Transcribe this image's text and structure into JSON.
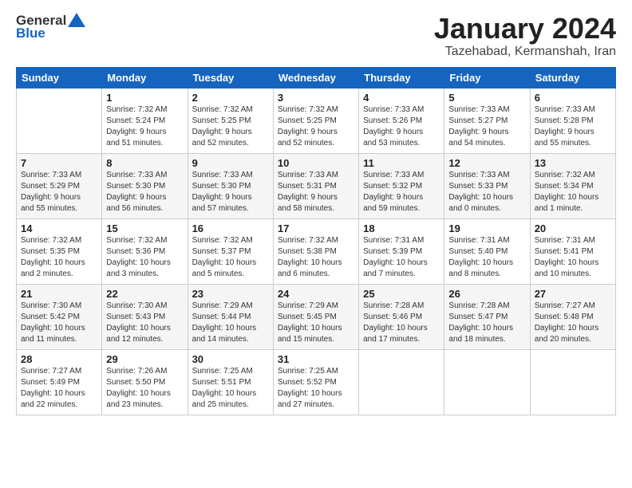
{
  "logo": {
    "general": "General",
    "blue": "Blue"
  },
  "title": "January 2024",
  "location": "Tazehabad, Kermanshah, Iran",
  "headers": [
    "Sunday",
    "Monday",
    "Tuesday",
    "Wednesday",
    "Thursday",
    "Friday",
    "Saturday"
  ],
  "weeks": [
    [
      {
        "day": "",
        "info": ""
      },
      {
        "day": "1",
        "info": "Sunrise: 7:32 AM\nSunset: 5:24 PM\nDaylight: 9 hours\nand 51 minutes."
      },
      {
        "day": "2",
        "info": "Sunrise: 7:32 AM\nSunset: 5:25 PM\nDaylight: 9 hours\nand 52 minutes."
      },
      {
        "day": "3",
        "info": "Sunrise: 7:32 AM\nSunset: 5:25 PM\nDaylight: 9 hours\nand 52 minutes."
      },
      {
        "day": "4",
        "info": "Sunrise: 7:33 AM\nSunset: 5:26 PM\nDaylight: 9 hours\nand 53 minutes."
      },
      {
        "day": "5",
        "info": "Sunrise: 7:33 AM\nSunset: 5:27 PM\nDaylight: 9 hours\nand 54 minutes."
      },
      {
        "day": "6",
        "info": "Sunrise: 7:33 AM\nSunset: 5:28 PM\nDaylight: 9 hours\nand 55 minutes."
      }
    ],
    [
      {
        "day": "7",
        "info": "Sunrise: 7:33 AM\nSunset: 5:29 PM\nDaylight: 9 hours\nand 55 minutes."
      },
      {
        "day": "8",
        "info": "Sunrise: 7:33 AM\nSunset: 5:30 PM\nDaylight: 9 hours\nand 56 minutes."
      },
      {
        "day": "9",
        "info": "Sunrise: 7:33 AM\nSunset: 5:30 PM\nDaylight: 9 hours\nand 57 minutes."
      },
      {
        "day": "10",
        "info": "Sunrise: 7:33 AM\nSunset: 5:31 PM\nDaylight: 9 hours\nand 58 minutes."
      },
      {
        "day": "11",
        "info": "Sunrise: 7:33 AM\nSunset: 5:32 PM\nDaylight: 9 hours\nand 59 minutes."
      },
      {
        "day": "12",
        "info": "Sunrise: 7:33 AM\nSunset: 5:33 PM\nDaylight: 10 hours\nand 0 minutes."
      },
      {
        "day": "13",
        "info": "Sunrise: 7:32 AM\nSunset: 5:34 PM\nDaylight: 10 hours\nand 1 minute."
      }
    ],
    [
      {
        "day": "14",
        "info": "Sunrise: 7:32 AM\nSunset: 5:35 PM\nDaylight: 10 hours\nand 2 minutes."
      },
      {
        "day": "15",
        "info": "Sunrise: 7:32 AM\nSunset: 5:36 PM\nDaylight: 10 hours\nand 3 minutes."
      },
      {
        "day": "16",
        "info": "Sunrise: 7:32 AM\nSunset: 5:37 PM\nDaylight: 10 hours\nand 5 minutes."
      },
      {
        "day": "17",
        "info": "Sunrise: 7:32 AM\nSunset: 5:38 PM\nDaylight: 10 hours\nand 6 minutes."
      },
      {
        "day": "18",
        "info": "Sunrise: 7:31 AM\nSunset: 5:39 PM\nDaylight: 10 hours\nand 7 minutes."
      },
      {
        "day": "19",
        "info": "Sunrise: 7:31 AM\nSunset: 5:40 PM\nDaylight: 10 hours\nand 8 minutes."
      },
      {
        "day": "20",
        "info": "Sunrise: 7:31 AM\nSunset: 5:41 PM\nDaylight: 10 hours\nand 10 minutes."
      }
    ],
    [
      {
        "day": "21",
        "info": "Sunrise: 7:30 AM\nSunset: 5:42 PM\nDaylight: 10 hours\nand 11 minutes."
      },
      {
        "day": "22",
        "info": "Sunrise: 7:30 AM\nSunset: 5:43 PM\nDaylight: 10 hours\nand 12 minutes."
      },
      {
        "day": "23",
        "info": "Sunrise: 7:29 AM\nSunset: 5:44 PM\nDaylight: 10 hours\nand 14 minutes."
      },
      {
        "day": "24",
        "info": "Sunrise: 7:29 AM\nSunset: 5:45 PM\nDaylight: 10 hours\nand 15 minutes."
      },
      {
        "day": "25",
        "info": "Sunrise: 7:28 AM\nSunset: 5:46 PM\nDaylight: 10 hours\nand 17 minutes."
      },
      {
        "day": "26",
        "info": "Sunrise: 7:28 AM\nSunset: 5:47 PM\nDaylight: 10 hours\nand 18 minutes."
      },
      {
        "day": "27",
        "info": "Sunrise: 7:27 AM\nSunset: 5:48 PM\nDaylight: 10 hours\nand 20 minutes."
      }
    ],
    [
      {
        "day": "28",
        "info": "Sunrise: 7:27 AM\nSunset: 5:49 PM\nDaylight: 10 hours\nand 22 minutes."
      },
      {
        "day": "29",
        "info": "Sunrise: 7:26 AM\nSunset: 5:50 PM\nDaylight: 10 hours\nand 23 minutes."
      },
      {
        "day": "30",
        "info": "Sunrise: 7:25 AM\nSunset: 5:51 PM\nDaylight: 10 hours\nand 25 minutes."
      },
      {
        "day": "31",
        "info": "Sunrise: 7:25 AM\nSunset: 5:52 PM\nDaylight: 10 hours\nand 27 minutes."
      },
      {
        "day": "",
        "info": ""
      },
      {
        "day": "",
        "info": ""
      },
      {
        "day": "",
        "info": ""
      }
    ]
  ]
}
